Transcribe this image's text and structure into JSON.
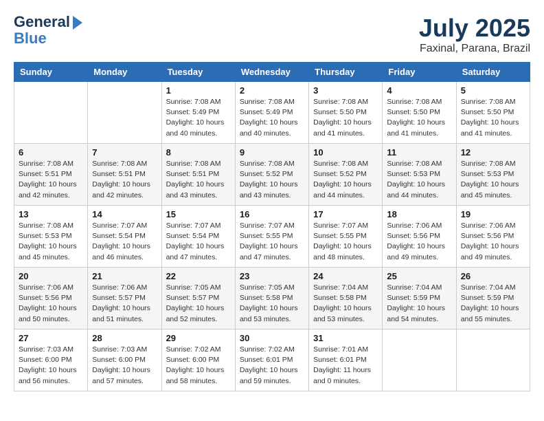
{
  "header": {
    "logo_line1": "General",
    "logo_line2": "Blue",
    "month": "July 2025",
    "location": "Faxinal, Parana, Brazil"
  },
  "weekdays": [
    "Sunday",
    "Monday",
    "Tuesday",
    "Wednesday",
    "Thursday",
    "Friday",
    "Saturday"
  ],
  "weeks": [
    [
      {
        "day": "",
        "info": ""
      },
      {
        "day": "",
        "info": ""
      },
      {
        "day": "1",
        "info": "Sunrise: 7:08 AM\nSunset: 5:49 PM\nDaylight: 10 hours and 40 minutes."
      },
      {
        "day": "2",
        "info": "Sunrise: 7:08 AM\nSunset: 5:49 PM\nDaylight: 10 hours and 40 minutes."
      },
      {
        "day": "3",
        "info": "Sunrise: 7:08 AM\nSunset: 5:50 PM\nDaylight: 10 hours and 41 minutes."
      },
      {
        "day": "4",
        "info": "Sunrise: 7:08 AM\nSunset: 5:50 PM\nDaylight: 10 hours and 41 minutes."
      },
      {
        "day": "5",
        "info": "Sunrise: 7:08 AM\nSunset: 5:50 PM\nDaylight: 10 hours and 41 minutes."
      }
    ],
    [
      {
        "day": "6",
        "info": "Sunrise: 7:08 AM\nSunset: 5:51 PM\nDaylight: 10 hours and 42 minutes."
      },
      {
        "day": "7",
        "info": "Sunrise: 7:08 AM\nSunset: 5:51 PM\nDaylight: 10 hours and 42 minutes."
      },
      {
        "day": "8",
        "info": "Sunrise: 7:08 AM\nSunset: 5:51 PM\nDaylight: 10 hours and 43 minutes."
      },
      {
        "day": "9",
        "info": "Sunrise: 7:08 AM\nSunset: 5:52 PM\nDaylight: 10 hours and 43 minutes."
      },
      {
        "day": "10",
        "info": "Sunrise: 7:08 AM\nSunset: 5:52 PM\nDaylight: 10 hours and 44 minutes."
      },
      {
        "day": "11",
        "info": "Sunrise: 7:08 AM\nSunset: 5:53 PM\nDaylight: 10 hours and 44 minutes."
      },
      {
        "day": "12",
        "info": "Sunrise: 7:08 AM\nSunset: 5:53 PM\nDaylight: 10 hours and 45 minutes."
      }
    ],
    [
      {
        "day": "13",
        "info": "Sunrise: 7:08 AM\nSunset: 5:53 PM\nDaylight: 10 hours and 45 minutes."
      },
      {
        "day": "14",
        "info": "Sunrise: 7:07 AM\nSunset: 5:54 PM\nDaylight: 10 hours and 46 minutes."
      },
      {
        "day": "15",
        "info": "Sunrise: 7:07 AM\nSunset: 5:54 PM\nDaylight: 10 hours and 47 minutes."
      },
      {
        "day": "16",
        "info": "Sunrise: 7:07 AM\nSunset: 5:55 PM\nDaylight: 10 hours and 47 minutes."
      },
      {
        "day": "17",
        "info": "Sunrise: 7:07 AM\nSunset: 5:55 PM\nDaylight: 10 hours and 48 minutes."
      },
      {
        "day": "18",
        "info": "Sunrise: 7:06 AM\nSunset: 5:56 PM\nDaylight: 10 hours and 49 minutes."
      },
      {
        "day": "19",
        "info": "Sunrise: 7:06 AM\nSunset: 5:56 PM\nDaylight: 10 hours and 49 minutes."
      }
    ],
    [
      {
        "day": "20",
        "info": "Sunrise: 7:06 AM\nSunset: 5:56 PM\nDaylight: 10 hours and 50 minutes."
      },
      {
        "day": "21",
        "info": "Sunrise: 7:06 AM\nSunset: 5:57 PM\nDaylight: 10 hours and 51 minutes."
      },
      {
        "day": "22",
        "info": "Sunrise: 7:05 AM\nSunset: 5:57 PM\nDaylight: 10 hours and 52 minutes."
      },
      {
        "day": "23",
        "info": "Sunrise: 7:05 AM\nSunset: 5:58 PM\nDaylight: 10 hours and 53 minutes."
      },
      {
        "day": "24",
        "info": "Sunrise: 7:04 AM\nSunset: 5:58 PM\nDaylight: 10 hours and 53 minutes."
      },
      {
        "day": "25",
        "info": "Sunrise: 7:04 AM\nSunset: 5:59 PM\nDaylight: 10 hours and 54 minutes."
      },
      {
        "day": "26",
        "info": "Sunrise: 7:04 AM\nSunset: 5:59 PM\nDaylight: 10 hours and 55 minutes."
      }
    ],
    [
      {
        "day": "27",
        "info": "Sunrise: 7:03 AM\nSunset: 6:00 PM\nDaylight: 10 hours and 56 minutes."
      },
      {
        "day": "28",
        "info": "Sunrise: 7:03 AM\nSunset: 6:00 PM\nDaylight: 10 hours and 57 minutes."
      },
      {
        "day": "29",
        "info": "Sunrise: 7:02 AM\nSunset: 6:00 PM\nDaylight: 10 hours and 58 minutes."
      },
      {
        "day": "30",
        "info": "Sunrise: 7:02 AM\nSunset: 6:01 PM\nDaylight: 10 hours and 59 minutes."
      },
      {
        "day": "31",
        "info": "Sunrise: 7:01 AM\nSunset: 6:01 PM\nDaylight: 11 hours and 0 minutes."
      },
      {
        "day": "",
        "info": ""
      },
      {
        "day": "",
        "info": ""
      }
    ]
  ]
}
